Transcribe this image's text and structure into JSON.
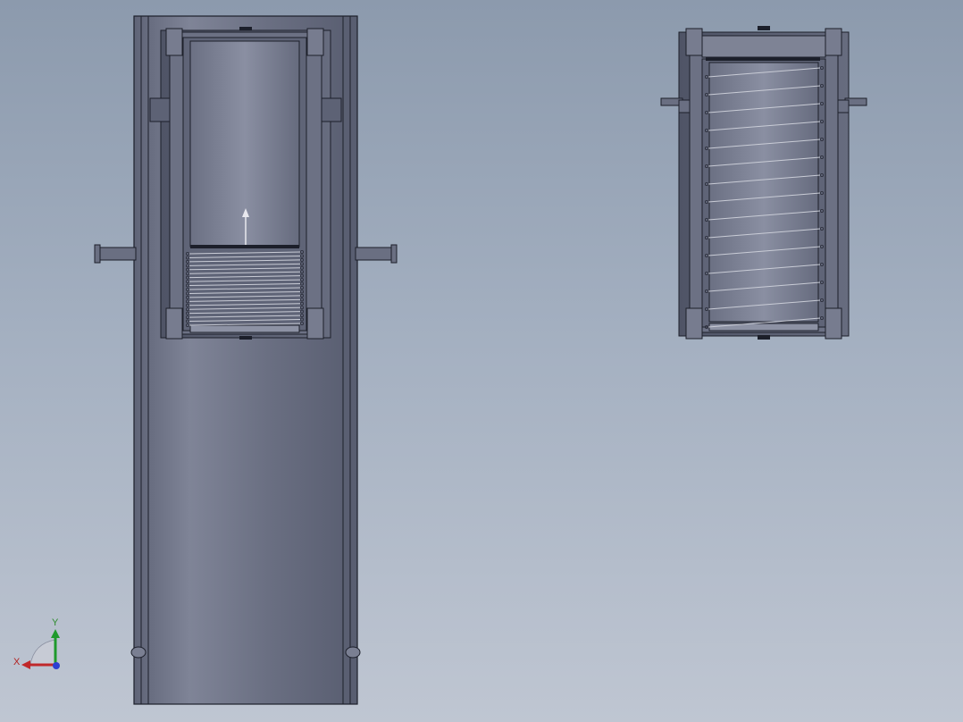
{
  "viewport": {
    "background_top": "#8c9aad",
    "background_bottom": "#bfc6d2",
    "body_color": "#6e7488",
    "body_dark": "#5d6275",
    "edge_color": "#1c1f2a",
    "spring_color": "#c9ccd6"
  },
  "triad": {
    "x_label": "X",
    "y_label": "Y",
    "x_color": "#c0282a",
    "y_color": "#1f9a2c",
    "z_color": "#2c3fd1"
  },
  "views": {
    "left_assembly": "section-view-full-housing",
    "right_assembly": "section-view-cartridge"
  }
}
